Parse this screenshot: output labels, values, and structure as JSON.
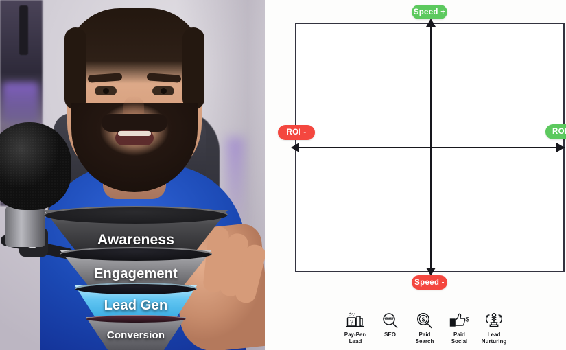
{
  "video": {
    "label": "webcam-presenter",
    "description": "Bearded man in blue shirt seated in office chair with studio microphone",
    "funnel": {
      "tiers": [
        {
          "label": "Awareness",
          "color": "#3a3a3d"
        },
        {
          "label": "Engagement",
          "color": "#8e8e93"
        },
        {
          "label": "Lead Gen",
          "color": "#56c2ef"
        },
        {
          "label": "Conversion",
          "color": "#76767c"
        }
      ]
    }
  },
  "slide": {
    "chart_data": {
      "type": "scatter",
      "title": "",
      "subtitle": "",
      "xlabel": "ROI",
      "ylabel": "Speed",
      "grid": false,
      "legend_position": "none",
      "quadrant": true,
      "axes": {
        "x": {
          "negative_label": "ROI -",
          "positive_label": "ROI +",
          "range_labels": [
            "ROI -",
            "ROI +"
          ]
        },
        "y": {
          "negative_label": "Speed -",
          "positive_label": "Speed +",
          "range_labels": [
            "Speed -",
            "Speed +"
          ]
        }
      },
      "axis_labels": [
        {
          "id": "speed-plus",
          "text": "Speed +",
          "position": "top",
          "color": "#5cc95e"
        },
        {
          "id": "speed-minus",
          "text": "Speed -",
          "position": "bottom",
          "color": "#f4473f"
        },
        {
          "id": "roi-minus",
          "text": "ROI -",
          "position": "left",
          "color": "#f4473f"
        },
        {
          "id": "roi-plus",
          "text": "ROI",
          "position": "right",
          "color": "#5cc95e"
        }
      ],
      "points": [],
      "annotations": []
    },
    "channels": [
      {
        "id": "pay-per-lead",
        "line1": "Pay-Per-",
        "line2": "Lead",
        "icon": "pay-per-lead-icon"
      },
      {
        "id": "seo",
        "line1": "SEO",
        "line2": "",
        "icon": "magnifier-seo-icon"
      },
      {
        "id": "paid-search",
        "line1": "Paid",
        "line2": "Search",
        "icon": "magnifier-dollar-icon"
      },
      {
        "id": "paid-social",
        "line1": "Paid",
        "line2": "Social",
        "icon": "thumbs-up-dollar-icon"
      },
      {
        "id": "lead-nurturing",
        "line1": "Lead",
        "line2": "Nurturing",
        "icon": "lead-nurturing-icon"
      }
    ]
  },
  "colors": {
    "green": "#5cc95e",
    "red": "#f4473f",
    "axis": "#17171d",
    "box_border": "#33333f",
    "slide_bg": "#fdfdfc"
  }
}
